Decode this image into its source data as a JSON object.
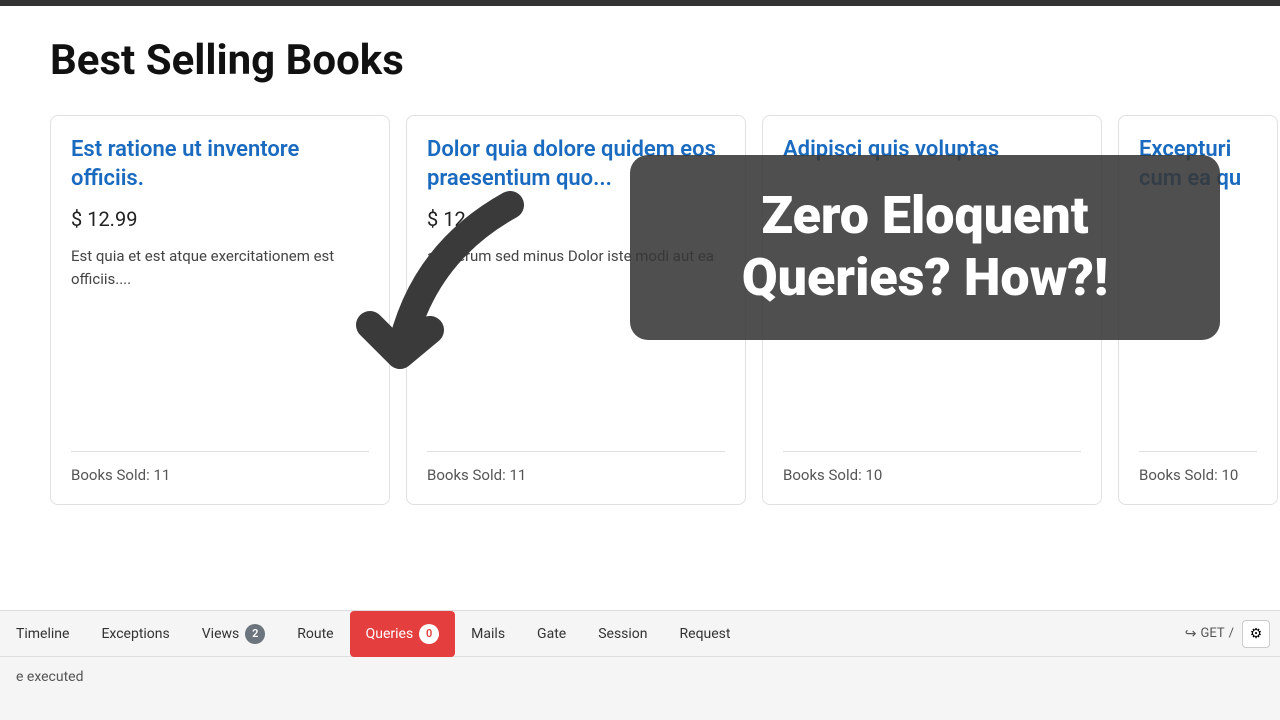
{
  "topbar": {},
  "page": {
    "title": "Best Selling Books"
  },
  "books": [
    {
      "id": 1,
      "title": "Est ratione ut inventore officiis.",
      "price": "$ 12.99",
      "description": "Est quia et est atque exercitationem est officiis....",
      "sold": "Books Sold: 11"
    },
    {
      "id": 2,
      "title": "Dolor quia dolore quidem eos praesentium quo...",
      "price": "$ 12.97",
      "description": "aut rerum sed minus Dolor iste modi aut ea at",
      "sold": "Books Sold: 11"
    },
    {
      "id": 3,
      "title": "Adipisci quis voluptas",
      "price": "",
      "description": "",
      "sold": "Books Sold: 10"
    },
    {
      "id": 4,
      "title": "Excepturi cum ea qu",
      "price": "",
      "description": "",
      "sold": "Books Sold: 10",
      "partial": true
    }
  ],
  "tooltip": {
    "line1": "Zero Eloquent",
    "line2": "Queries? How?!"
  },
  "toolbar": {
    "tabs": [
      {
        "label": "Timeline",
        "badge": null,
        "active": false
      },
      {
        "label": "Exceptions",
        "badge": null,
        "active": false
      },
      {
        "label": "Views",
        "badge": "2",
        "active": false
      },
      {
        "label": "Route",
        "badge": null,
        "active": false
      },
      {
        "label": "Queries",
        "badge": "0",
        "active": true
      },
      {
        "label": "Mails",
        "badge": null,
        "active": false
      },
      {
        "label": "Gate",
        "badge": null,
        "active": false
      },
      {
        "label": "Session",
        "badge": null,
        "active": false
      },
      {
        "label": "Request",
        "badge": null,
        "active": false
      }
    ],
    "method": "GET",
    "status_text": "e executed"
  }
}
